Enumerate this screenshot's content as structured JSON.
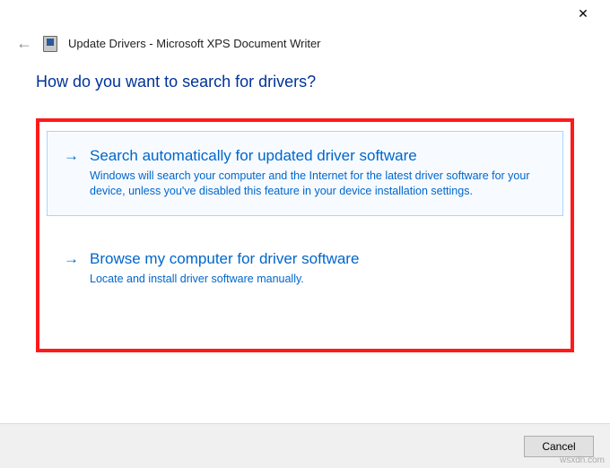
{
  "titlebar": {
    "close_symbol": "✕"
  },
  "header": {
    "back_symbol": "←",
    "window_title": "Update Drivers - Microsoft XPS Document Writer"
  },
  "content": {
    "question": "How do you want to search for drivers?"
  },
  "options": {
    "arrow_symbol": "→",
    "auto": {
      "title": "Search automatically for updated driver software",
      "description": "Windows will search your computer and the Internet for the latest driver software for your device, unless you've disabled this feature in your device installation settings."
    },
    "browse": {
      "title": "Browse my computer for driver software",
      "description": "Locate and install driver software manually."
    }
  },
  "footer": {
    "cancel_label": "Cancel"
  },
  "watermark": "wsxdn.com"
}
